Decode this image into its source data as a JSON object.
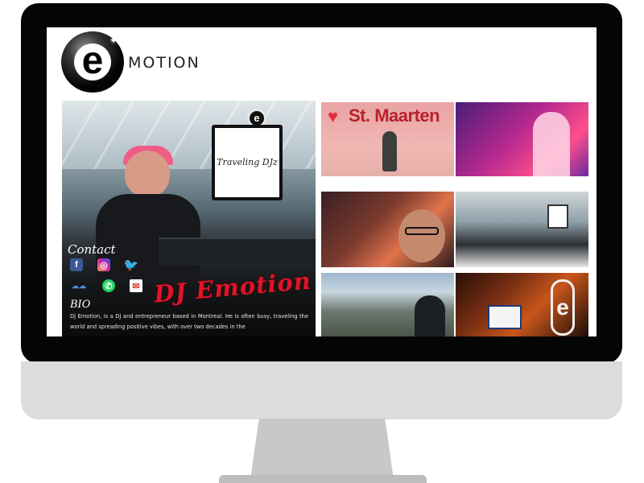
{
  "site": {
    "logo_letter": "e",
    "logo_text": "MOTION"
  },
  "hero": {
    "laptop_text": "Traveling DJz",
    "mini_logo_letter": "e",
    "contact_title": "Contact",
    "social_icons": [
      "facebook-icon",
      "instagram-icon",
      "twitter-icon",
      "mixcloud-icon",
      "whatsapp-icon",
      "email-icon"
    ],
    "social_glyphs": {
      "facebook": "f",
      "instagram": "◎",
      "twitter": "🐦",
      "mixcloud": "☁☁",
      "whatsapp": "✆",
      "email": "✉"
    },
    "signature": "DJ Emotion",
    "bio_title": "BIO",
    "bio_text": "Dj Emotion, is a DJ and entrepreneur based in Montreal. He is often busy, traveling the world and spreading positive vibes, with over two decades in the"
  },
  "gallery": {
    "photo1_title": "St. Maarten",
    "photo1_heart": "♥",
    "photo6_letter": "e",
    "photos": [
      "st-maarten",
      "pink-stage",
      "selfie",
      "dj-booth",
      "mountain-view",
      "club-stage"
    ]
  },
  "colors": {
    "signature_red": "#e0142a",
    "monitor_bezel": "#050505",
    "monitor_chin": "#dcdcdc"
  }
}
